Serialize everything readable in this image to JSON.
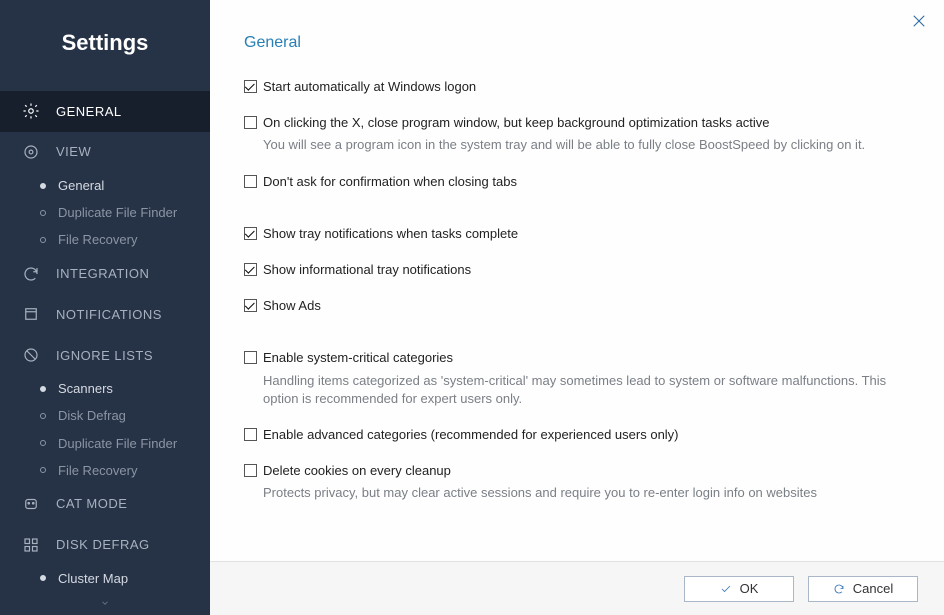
{
  "sidebar": {
    "title": "Settings",
    "items": [
      {
        "label": "GENERAL",
        "icon": "gear"
      },
      {
        "label": "VIEW",
        "icon": "eye"
      },
      {
        "label": "INTEGRATION",
        "icon": "sync"
      },
      {
        "label": "NOTIFICATIONS",
        "icon": "bell"
      },
      {
        "label": "IGNORE LISTS",
        "icon": "ban"
      },
      {
        "label": "CAT MODE",
        "icon": "cat"
      },
      {
        "label": "DISK DEFRAG",
        "icon": "grid"
      }
    ],
    "view_sub": [
      "General",
      "Duplicate File Finder",
      "File Recovery"
    ],
    "ignore_sub": [
      "Scanners",
      "Disk Defrag",
      "Duplicate File Finder",
      "File Recovery"
    ],
    "defrag_sub": [
      "Cluster Map"
    ]
  },
  "main": {
    "heading": "General",
    "options": [
      {
        "checked": true,
        "label": "Start automatically at Windows logon"
      },
      {
        "checked": false,
        "label": "On clicking the X, close program window, but keep background optimization tasks active",
        "desc": "You will see a program icon in the system tray and will be able to fully close BoostSpeed by clicking on it."
      },
      {
        "checked": false,
        "label": "Don't ask for confirmation when closing tabs"
      },
      {
        "checked": true,
        "label": "Show tray notifications when tasks complete"
      },
      {
        "checked": true,
        "label": "Show informational tray notifications"
      },
      {
        "checked": true,
        "label": "Show Ads"
      },
      {
        "checked": false,
        "label": "Enable system-critical categories",
        "desc": "Handling items categorized as 'system-critical' may sometimes lead to system or software malfunctions. This option is recommended for expert users only."
      },
      {
        "checked": false,
        "label": "Enable advanced categories (recommended for experienced users only)"
      },
      {
        "checked": false,
        "label": "Delete cookies on every cleanup",
        "desc": "Protects privacy, but may clear active sessions and require you to re-enter login info on websites"
      }
    ]
  },
  "footer": {
    "ok": "OK",
    "cancel": "Cancel"
  }
}
